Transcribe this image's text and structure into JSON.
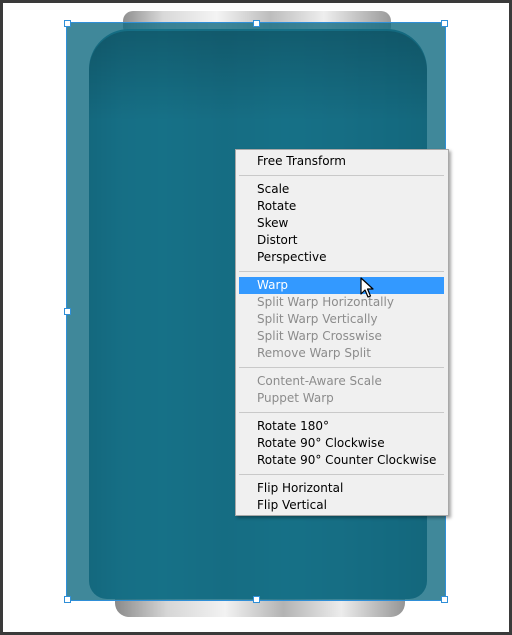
{
  "menu": {
    "groups": [
      [
        {
          "label": "Free Transform",
          "enabled": true
        }
      ],
      [
        {
          "label": "Scale",
          "enabled": true
        },
        {
          "label": "Rotate",
          "enabled": true
        },
        {
          "label": "Skew",
          "enabled": true
        },
        {
          "label": "Distort",
          "enabled": true
        },
        {
          "label": "Perspective",
          "enabled": true
        }
      ],
      [
        {
          "label": "Warp",
          "enabled": true,
          "highlighted": true
        },
        {
          "label": "Split Warp Horizontally",
          "enabled": false
        },
        {
          "label": "Split Warp Vertically",
          "enabled": false
        },
        {
          "label": "Split Warp Crosswise",
          "enabled": false
        },
        {
          "label": "Remove Warp Split",
          "enabled": false
        }
      ],
      [
        {
          "label": "Content-Aware Scale",
          "enabled": false
        },
        {
          "label": "Puppet Warp",
          "enabled": false
        }
      ],
      [
        {
          "label": "Rotate 180°",
          "enabled": true
        },
        {
          "label": "Rotate 90° Clockwise",
          "enabled": true
        },
        {
          "label": "Rotate 90° Counter Clockwise",
          "enabled": true
        }
      ],
      [
        {
          "label": "Flip Horizontal",
          "enabled": true
        },
        {
          "label": "Flip Vertical",
          "enabled": true
        }
      ]
    ]
  },
  "colors": {
    "can_body": "#17748c",
    "selection_outline": "#2f8fd8",
    "menu_highlight": "#3399ff",
    "menu_background": "#f0f0f0"
  },
  "cursor_icon": "arrow-cursor-icon"
}
